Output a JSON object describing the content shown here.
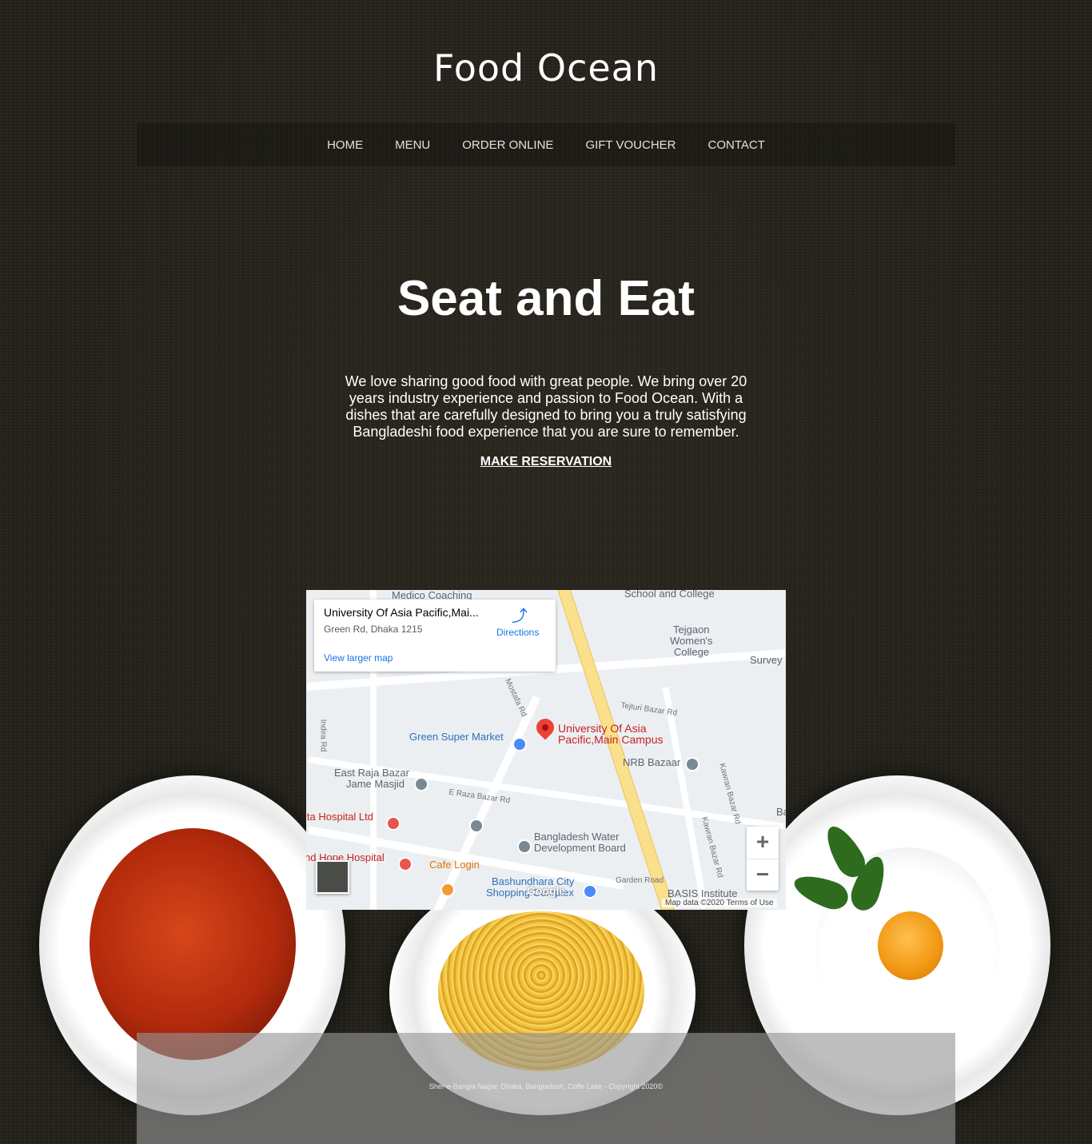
{
  "brand": {
    "name": "Food Ocean"
  },
  "nav": {
    "items": [
      {
        "label": "HOME"
      },
      {
        "label": "MENU"
      },
      {
        "label": "ORDER ONLINE"
      },
      {
        "label": "GIFT VOUCHER"
      },
      {
        "label": "CONTACT"
      }
    ]
  },
  "hero": {
    "title": "Seat and Eat",
    "description": "We love sharing good food with great people. We bring over 20 years industry experience and passion to Food Ocean. With a dishes that are carefully designed to bring you a truly satisfying Bangladeshi food experience that you are sure to remember.",
    "cta_label": "MAKE RESERVATION"
  },
  "map": {
    "place_title": "University Of Asia Pacific,Mai...",
    "address": "Green Rd, Dhaka 1215",
    "view_larger": "View larger map",
    "directions": "Directions",
    "marker_label_line1": "University Of Asia",
    "marker_label_line2": "Pacific,Main Campus",
    "labels": {
      "medico": "Medico Coaching",
      "school": "School and College",
      "tejgaon1": "Tejgaon",
      "tejgaon2": "Women's",
      "tejgaon3": "College",
      "survey": "Survey",
      "tejturi": "Tejturi Bazar Rd",
      "mostafa": "Mostafa Rd",
      "green_super": "Green Super Market",
      "nrb": "NRB Bazaar",
      "east_raja1": "East Raja Bazar",
      "east_raja2": "Jame Masjid",
      "e_raza": "E Raza Bazar Rd",
      "kawran1": "Kawran Bazar Rd",
      "kawran2": "Kawran Bazar Rd",
      "hospital1": "ita Hospital Ltd",
      "hospital2": "nd Hope Hospital",
      "bwdb1": "Bangladesh Water",
      "bwdb2": "Development Board",
      "cafe": "Cafe Login",
      "bashundhara1": "Bashundhara City",
      "bashundhara2": "Shopping Complex",
      "garden": "Garden Road",
      "basis": "BASIS Institute",
      "indira": "Indira Rd",
      "ba": "Ba"
    },
    "google": "Google",
    "map_data": "Map data ©2020   Terms of Use",
    "zoom_in": "+",
    "zoom_out": "−"
  },
  "footer": {
    "text": "Sher-e-Bangla Nagar, Dhaka, Bangladesh, Coffe Lake - Copyright 2020©"
  },
  "icons": {
    "directions": "directions-icon",
    "marker": "map-pin-icon",
    "zoom_in": "plus-icon",
    "zoom_out": "minus-icon"
  }
}
